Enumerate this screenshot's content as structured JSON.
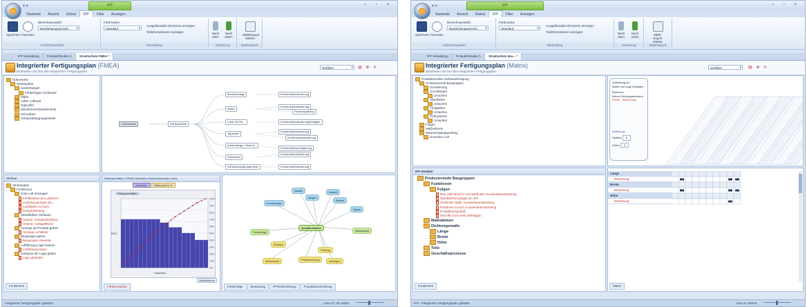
{
  "left": {
    "context_tab": "IFP",
    "ribbon_tabs": [
      "Startseite",
      "Ansicht",
      "Global",
      "IFP",
      "Filter",
      "Anzeigen"
    ],
    "active_ribbon_tab": 3,
    "groups": {
      "save": "Speichern",
      "favoriten": "Favoriten",
      "label_a": "Bereichsauswahl",
      "combo_a": "Bearbeitungsansicht",
      "label_b": "Farbmodus",
      "combo_b": "Standard",
      "opt_1": "Ausgeblendete Elemente anzeigen",
      "opt_2": "Teilinformationen anzeigen",
      "btn_1": "Nach oben",
      "btn_2": "Nach unten",
      "btn_3": "MDB/Export starten",
      "glabel_1": "Ansichtsauswahl",
      "glabel_2": "Darstellung",
      "glabel_3": "Sortierung",
      "glabel_4": "Datenexport"
    },
    "doc_tabs": [
      "IFP-Verwaltung",
      "Produkt/Struktur 1",
      "Strukturliste FMEA *"
    ],
    "title": "Integrierter Fertigungsplan",
    "title_suffix": "(FMEA)",
    "subtitle": "Bearbeiten Sie hier den Integrierten Fertigungsplan",
    "view_combo": "Grafiken",
    "tree_top": [
      {
        "t": "Dokumente",
        "lvl": 0
      },
      {
        "t": "Strukturplan",
        "lvl": 1
      },
      {
        "t": "Kantenbiegen",
        "lvl": 2
      },
      {
        "t": "Fehlerfolgen Schlüssel",
        "lvl": 3
      },
      {
        "t": "Maße",
        "lvl": 2
      },
      {
        "t": "Lüfter Lüfterart",
        "lvl": 2
      },
      {
        "t": "Typschild",
        "lvl": 2
      },
      {
        "t": "Montierte/Anbauelemente",
        "lvl": 2
      },
      {
        "t": "Schrauben",
        "lvl": 2
      },
      {
        "t": "Gehäusebaugruppenteile",
        "lvl": 2
      }
    ],
    "diagram": {
      "root": "Lüfterschale",
      "mid": "Gehäusefüße",
      "branches": [
        "Montieranlage",
        "Aktive",
        "Lüfter für Re...",
        "Typschild",
        "Kantenbieger / Bohrfa...",
        "Schrauben",
        "Gehäusebaugruppenteile"
      ],
      "leaves": [
        "Konstruktionsänderung",
        "Konstruktionsänderung",
        "Prozessplanung",
        "Konstruktionsänderungsfreigabe",
        "Konstruktionsänderung",
        "Konstruktionsänderung",
        "Konstruktionsverlagerung",
        "Konstruktionsänderung",
        "Konstruktionsänderung"
      ]
    },
    "tree_bottom_title": "Struktur",
    "tree_bottom": [
      {
        "t": "Strukturplan",
        "lvl": 0,
        "red": false
      },
      {
        "t": "Funktionen",
        "lvl": 1,
        "red": false
      },
      {
        "t": "Gute Luft ansaugen",
        "lvl": 2,
        "red": false
      },
      {
        "t": "Fehlfunktion bei Luftstrom",
        "lvl": 3,
        "red": true
      },
      {
        "t": "Leistung geringer als...",
        "lvl": 3,
        "red": true
      },
      {
        "t": "Lautstärke zu hoch",
        "lvl": 3,
        "red": true
      },
      {
        "t": "Gesamtleistung",
        "lvl": 3,
        "red": true
      },
      {
        "t": "Standhaften Gehäuse",
        "lvl": 2,
        "red": false
      },
      {
        "t": "Unterst. Gehäusefunktion",
        "lvl": 3,
        "red": true
      },
      {
        "t": "Unterst. Auflagefläche",
        "lvl": 3,
        "red": true
      },
      {
        "t": "Anzeige auf Produkt geben",
        "lvl": 2,
        "red": false
      },
      {
        "t": "Anzeige Lichtleiter",
        "lvl": 3,
        "red": true
      },
      {
        "t": "Baugruppe geben",
        "lvl": 2,
        "red": false
      },
      {
        "t": "Baugruppe Gewinde",
        "lvl": 3,
        "red": true
      },
      {
        "t": "Luftführung Lage fixieren",
        "lvl": 2,
        "red": false
      },
      {
        "t": "Luftführung lösen",
        "lvl": 3,
        "red": true
      },
      {
        "t": "Gehäuse der Lage geben",
        "lvl": 2,
        "red": false
      },
      {
        "t": "Lage geändert",
        "lvl": 3,
        "red": true
      }
    ],
    "tree_bottom_tab": "Funktionen",
    "mid_tabs": [
      "Risikoprioritäten",
      "FMEA Übersicht",
      "Maßnahmenplan",
      "Netz"
    ],
    "chart_buttons": [
      "Ansichten",
      "Risikozahl in %"
    ],
    "chart_title": "Risikoprioritäten",
    "chart_axis_left": "RPZ",
    "chart_axis_bottom": "Ursachen",
    "chart_btn": "Aktualisieren",
    "mid_bottom_tab": "Fehlerursache",
    "right_tabs": [
      "Fehlerfolge",
      "Bewertung",
      "IFPM-Beziehung",
      "Projektbeschreibung"
    ],
    "mindmap_center": "Ausfallursache",
    "mindmap_nodes": [
      {
        "t": "Bauteil",
        "c": "#a8d8f0"
      },
      {
        "t": "Bauteil",
        "c": "#a8d8f0"
      },
      {
        "t": "Kombination",
        "c": "#a8d8f0"
      },
      {
        "t": "Biegen",
        "c": "#a8d8f0"
      },
      {
        "t": "Bauteil",
        "c": "#a8d8f0"
      },
      {
        "t": "Signal",
        "c": "#a8d8f0"
      },
      {
        "t": "Maßnahme",
        "c": "#c8e89a"
      },
      {
        "t": "Fehlerfolge",
        "c": "#c8e89a"
      },
      {
        "t": "Einfluss",
        "c": "#f2e27a"
      },
      {
        "t": "Prüfung",
        "c": "#f2e27a"
      },
      {
        "t": "Prüfanweisung",
        "c": "#f2e27a"
      },
      {
        "t": "Anzeigen",
        "c": "#f2e27a"
      },
      {
        "t": "Maßnahme",
        "c": "#f2e27a"
      }
    ],
    "status": "Integrierter Fertigungsplan geladen",
    "status_right": "Linux 8 / 30 Laden"
  },
  "right": {
    "context_tab": "IFP",
    "ribbon_tabs": [
      "Startseite",
      "Ansicht",
      "Global",
      "IFP",
      "Filter",
      "Anzeigen"
    ],
    "active_ribbon_tab": 3,
    "groups": {
      "save": "Speichern",
      "favoriten": "Favoriten",
      "label_a": "Bereichsauswahl",
      "combo_a": "Bearbeitungsansicht",
      "label_b": "Farbmodus",
      "combo_b": "Standard",
      "opt_1": "Ausgeblendete Elemente anzeigen",
      "opt_2": "Teilinformationen anzeigen",
      "btn_1": "Nach oben",
      "btn_2": "Nach unten",
      "btn_3": "MDB-Export starten",
      "glabel_1": "Ansichtsauswahl",
      "glabel_2": "Darstellung",
      "glabel_3": "Sortierung",
      "glabel_4": "Datenexport"
    },
    "doc_tabs": [
      "IFP-Verwaltung",
      "Produkt/Struktur 1",
      "Strukturliste (Hu... *"
    ],
    "title": "Integrierter Fertigungsplan",
    "title_suffix": "(Matrix)",
    "subtitle": "Bearbeiten Sie hier den Integrierten Fertigungsplan",
    "view_combo": "Grafiken",
    "tree_top": [
      {
        "t": "Produktionslinie Gehäusefertigung",
        "lvl": 0
      },
      {
        "t": "Produzierende Baugruppen",
        "lvl": 1
      },
      {
        "t": "Grundierung",
        "lvl": 2
      },
      {
        "t": "Grundkörper",
        "lvl": 2
      },
      {
        "t": "Ursachen",
        "lvl": 3
      },
      {
        "t": "Oberfläche",
        "lvl": 2
      },
      {
        "t": "Ursachen",
        "lvl": 3
      },
      {
        "t": "Fertigteilen",
        "lvl": 2
      },
      {
        "t": "Ursachen",
        "lvl": 3
      },
      {
        "t": "Prüfsysteme",
        "lvl": 2
      },
      {
        "t": "Ursachen",
        "lvl": 3
      },
      {
        "t": "Folgen",
        "lvl": 1
      },
      {
        "t": "Maßnahmen",
        "lvl": 1
      },
      {
        "t": "Wareneingangsprüfung",
        "lvl": 1
      },
      {
        "t": "Ursachen Luft",
        "lvl": 2
      }
    ],
    "infobox": {
      "l1": "Anbindung an:",
      "l2": "Maße und Lage festlegen",
      "l3": "Referenz:",
      "l4": "Neues Dichtungselement",
      "l5": "Fehler - Bewertung",
      "l6": "Auflösung:",
      "l7": "Spalten",
      "l8": "Zeilen",
      "v7": "5",
      "v8": "3"
    },
    "lower_title": "IFP-Struktur",
    "lower_tree": [
      {
        "t": "Produzierende Baugruppen",
        "lvl": 0,
        "red": false,
        "bold": true
      },
      {
        "t": "Funktionen",
        "lvl": 1,
        "red": false,
        "bold": true
      },
      {
        "t": "Folgen",
        "lvl": 2,
        "red": false,
        "bold": true
      },
      {
        "t": "Riss oder Bruch in Schweißnaht, Kundenbeanstandung",
        "lvl": 3,
        "red": true,
        "bold": false
      },
      {
        "t": "Oberflächenmängel am Teil",
        "lvl": 3,
        "red": true,
        "bold": false
      },
      {
        "t": "Schlechte Optik, Kundenbeanstandung",
        "lvl": 3,
        "red": true,
        "bold": false
      },
      {
        "t": "Passform zu kurz, Kundenbeanstandung",
        "lvl": 3,
        "red": true,
        "bold": false
      },
      {
        "t": "Produktionsausfall",
        "lvl": 3,
        "red": true,
        "bold": false
      },
      {
        "t": "Teil trifft nicht mehr befestigen",
        "lvl": 3,
        "red": true,
        "bold": false
      },
      {
        "t": "Maßnahmen",
        "lvl": 1,
        "red": false,
        "bold": true
      },
      {
        "t": "Dichtungsmaße",
        "lvl": 1,
        "red": false,
        "bold": true
      },
      {
        "t": "Länge",
        "lvl": 2,
        "red": false,
        "bold": true
      },
      {
        "t": "Breite",
        "lvl": 2,
        "red": false,
        "bold": true
      },
      {
        "t": "Höhe",
        "lvl": 2,
        "red": false,
        "bold": true
      },
      {
        "t": "Teile",
        "lvl": 1,
        "red": false,
        "bold": true
      },
      {
        "t": "Geschäftsprozesse",
        "lvl": 1,
        "red": false,
        "bold": true
      }
    ],
    "lower_tab": "Funktionen",
    "matrix_rows": [
      {
        "t": "Länge",
        "head": true
      },
      {
        "t": "Bewertung",
        "head": false
      },
      {
        "t": "Breite",
        "head": true
      },
      {
        "t": "Bewertung",
        "head": false
      },
      {
        "t": "Höhe",
        "head": true
      },
      {
        "t": "Bewertung",
        "head": false
      }
    ],
    "matrix_tab": "Matrix",
    "status": "IFP - Integrierter Fertigungsplan geladen",
    "status_right": "Linux 8 / Bereit"
  },
  "colors": {
    "accent": "#2f5a94",
    "chart_bar": "#4545b0",
    "chart_line": "#b0204a",
    "red_text": "#c0392b"
  },
  "chart_data": {
    "type": "bar",
    "title": "Risikoprioritäten",
    "xlabel": "Ursachen",
    "ylabel": "RPZ",
    "categories": [
      "1",
      "2",
      "3",
      "4",
      "5",
      "6",
      "7",
      "8",
      "9",
      "10",
      "11",
      "12",
      "13",
      "14",
      "15",
      "16",
      "17",
      "18",
      "19",
      "20"
    ],
    "series": [
      {
        "name": "Ansichten",
        "values": [
          210,
          210,
          210,
          210,
          210,
          210,
          210,
          210,
          210,
          195,
          195,
          175,
          175,
          175,
          150,
          150,
          150,
          120,
          120,
          120
        ]
      },
      {
        "name": "Risikozahl in %",
        "values": [
          6,
          12,
          18,
          24,
          30,
          36,
          42,
          48,
          54,
          59,
          64,
          69,
          74,
          78,
          82,
          86,
          90,
          94,
          97,
          100
        ]
      }
    ],
    "ylim": [
      0,
      300
    ],
    "y2lim": [
      0,
      100
    ]
  }
}
